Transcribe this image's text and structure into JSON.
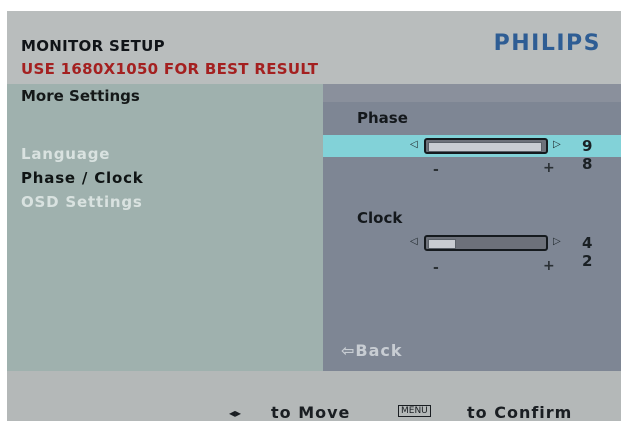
{
  "header": {
    "title": "MONITOR SETUP",
    "subtitle": "USE 1680X1050 FOR BEST RESULT",
    "brand": "PHILIPS"
  },
  "left_panel": {
    "section_title": "More Settings",
    "menu": [
      {
        "label": "Language",
        "state": "inactive"
      },
      {
        "label": "Phase / Clock",
        "state": "active"
      },
      {
        "label": "OSD Settings",
        "state": "inactive"
      }
    ]
  },
  "right_panel": {
    "phase": {
      "label": "Phase",
      "value": "9 8",
      "minus": "-",
      "plus": "+",
      "level": 0.98
    },
    "clock": {
      "label": "Clock",
      "value": "4 2",
      "minus": "-",
      "plus": "+",
      "level": 0.42
    },
    "back_label": "Back",
    "back_icon": "back-arrow-icon"
  },
  "footer": {
    "move_label": "to Move",
    "move_icon": "left-right-arrows-icon",
    "menu_key": "MENU",
    "confirm_label": "to Confirm"
  },
  "colors": {
    "highlight": "#82d2d8",
    "subtitle": "#a42020",
    "brand": "#2e5d94"
  }
}
